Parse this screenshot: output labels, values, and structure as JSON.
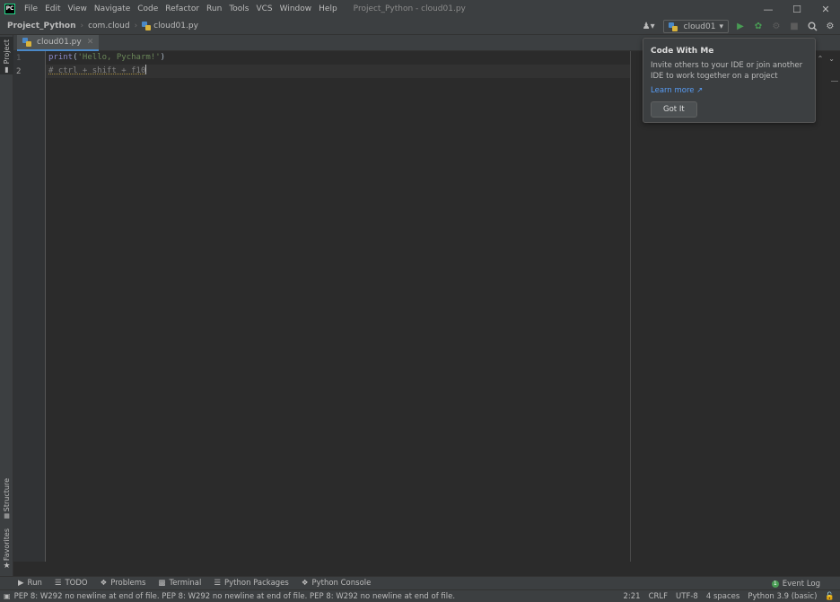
{
  "menubar": {
    "items": [
      "File",
      "Edit",
      "View",
      "Navigate",
      "Code",
      "Refactor",
      "Run",
      "Tools",
      "VCS",
      "Window",
      "Help"
    ],
    "window_title": "Project_Python - cloud01.py",
    "logo_text": "PC"
  },
  "breadcrumbs": {
    "project": "Project_Python",
    "package": "com.cloud",
    "file": "cloud01.py"
  },
  "toolbar": {
    "run_config": "cloud01"
  },
  "side_tabs": {
    "project": "Project",
    "structure": "Structure",
    "favorites": "Favorites"
  },
  "editor": {
    "tab_label": "cloud01.py",
    "line_numbers": [
      "1",
      "2"
    ],
    "lines": {
      "l1_fn": "print",
      "l1_open": "(",
      "l1_str": "'Hello, Pycharm!'",
      "l1_close": ")",
      "l2_comment": "# ctrl + shift + f10"
    }
  },
  "popup": {
    "title": "Code With Me",
    "body": "Invite others to your IDE or join another IDE to work together on a project",
    "link": "Learn more ↗",
    "button": "Got It"
  },
  "bottom_tools": {
    "run": "Run",
    "todo": "TODO",
    "problems": "Problems",
    "terminal": "Terminal",
    "packages": "Python Packages",
    "console": "Python Console",
    "event_log": "Event Log"
  },
  "statusbar": {
    "message": "PEP 8: W292 no newline at end of file. PEP 8: W292 no newline at end of file. PEP 8: W292 no newline at end of file.",
    "position": "2:21",
    "line_sep": "CRLF",
    "encoding": "UTF-8",
    "indent": "4 spaces",
    "interpreter": "Python 3.9 (basic)"
  },
  "colors": {
    "accent": "#4a88c7",
    "run_green": "#499c54",
    "background": "#2b2b2b"
  }
}
